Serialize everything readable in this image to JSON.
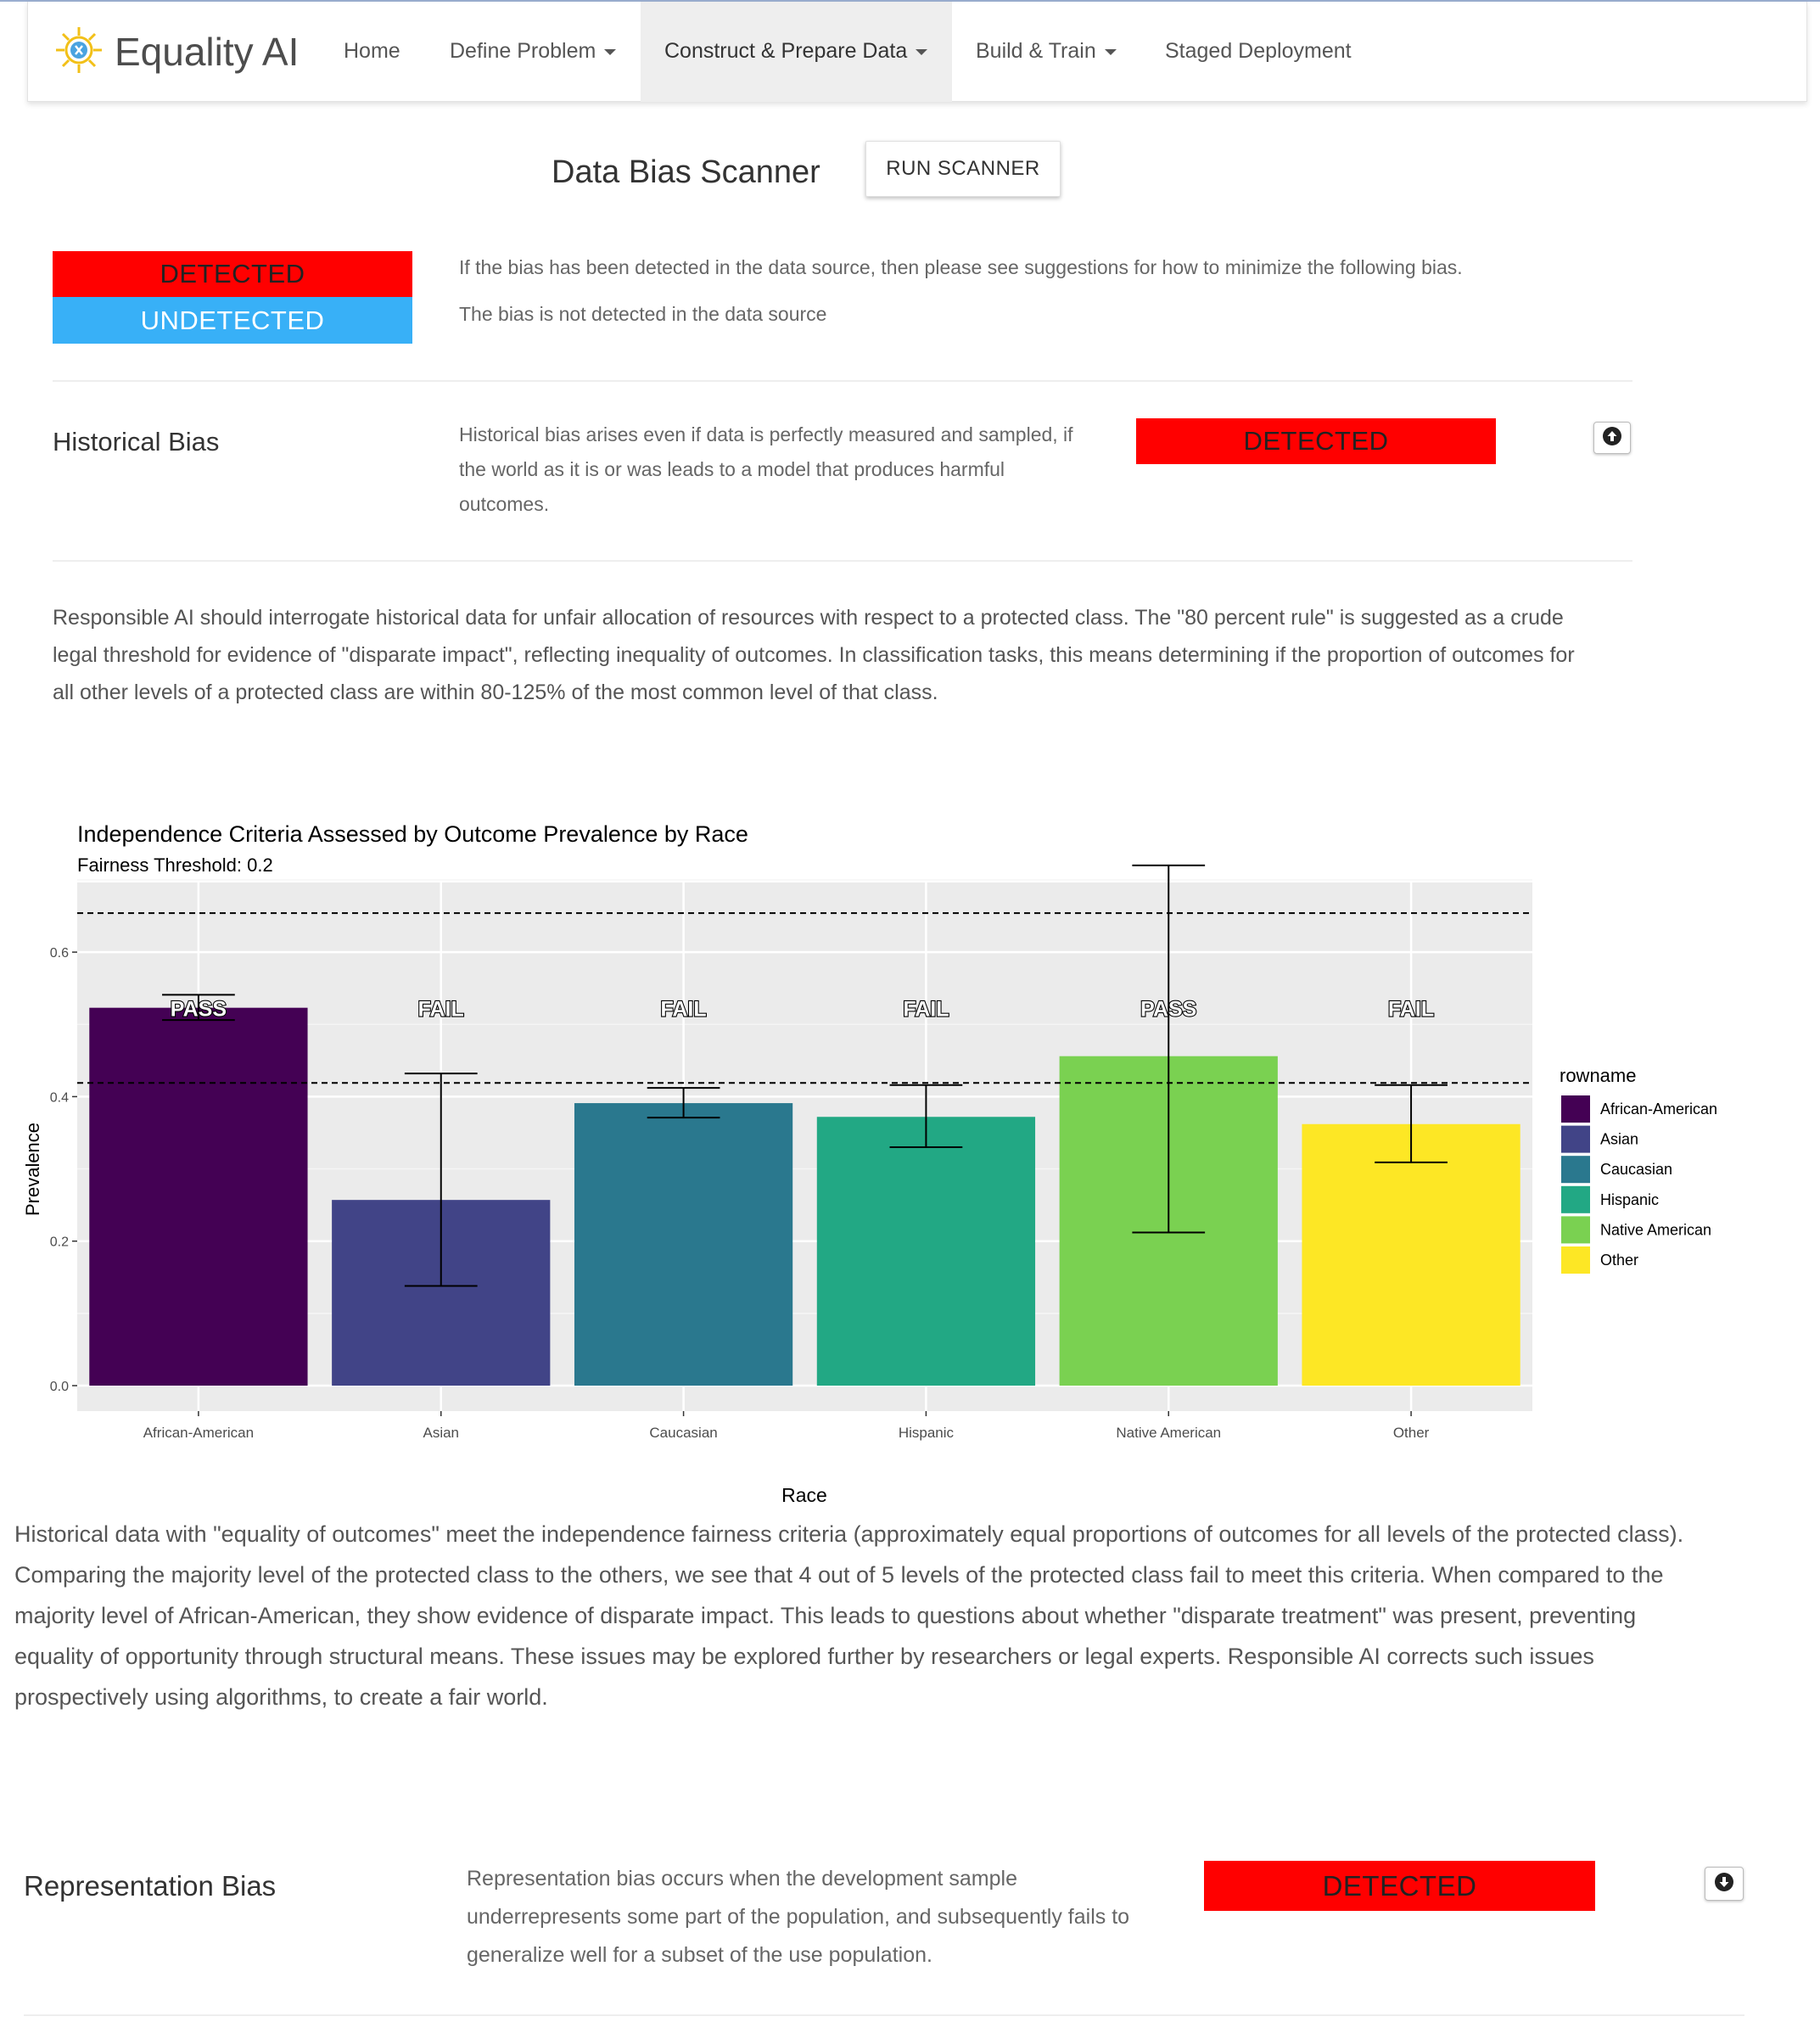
{
  "nav": {
    "brand": "Equality AI",
    "items": [
      {
        "label": "Home",
        "dropdown": false,
        "active": false
      },
      {
        "label": "Define Problem",
        "dropdown": true,
        "active": false
      },
      {
        "label": "Construct & Prepare Data",
        "dropdown": true,
        "active": true
      },
      {
        "label": "Build & Train",
        "dropdown": true,
        "active": false
      },
      {
        "label": "Staged Deployment",
        "dropdown": false,
        "active": false
      }
    ]
  },
  "scanner": {
    "title": "Data Bias Scanner",
    "run_label": "RUN SCANNER",
    "detected_label": "DETECTED",
    "undetected_label": "UNDETECTED",
    "detected_note": "If the bias has been detected in the data source, then please see suggestions for how to minimize the following bias.",
    "undetected_note": "The bias is not detected in the data source"
  },
  "historical": {
    "title": "Historical Bias",
    "desc_lines": [
      "Historical bias arises even if data is perfectly measured and sampled, if",
      "the world as it is or was leads to a model that produces harmful",
      "outcomes."
    ],
    "status": "DETECTED",
    "para_lines": [
      "Responsible AI should interrogate historical data for unfair allocation of resources with respect to a protected class. The \"80 percent rule\" is suggested as a crude",
      "legal threshold for evidence of \"disparate impact\", reflecting inequality of outcomes. In classification tasks, this means determining if the proportion of outcomes for",
      "all other levels of a protected class are within 80-125% of the most common level of that class."
    ]
  },
  "chart_data": {
    "type": "bar",
    "title": "Independence Criteria Assessed by Outcome Prevalence by Race",
    "subtitle": "Fairness Threshold: 0.2",
    "xlabel": "Race",
    "ylabel": "Prevalence",
    "ylim": [
      0,
      0.75
    ],
    "yticks": [
      0.0,
      0.2,
      0.4,
      0.6
    ],
    "ytick_labels": [
      "0.0",
      "0.2",
      "0.4",
      "0.6"
    ],
    "categories": [
      "African-American",
      "Asian",
      "Caucasian",
      "Hispanic",
      "Native American",
      "Other"
    ],
    "values": [
      0.523,
      0.257,
      0.391,
      0.372,
      0.456,
      0.362
    ],
    "error_low": [
      0.506,
      0.138,
      0.371,
      0.33,
      0.212,
      0.309
    ],
    "error_high": [
      0.541,
      0.432,
      0.412,
      0.416,
      0.72,
      0.416
    ],
    "labels": [
      "PASS",
      "FAIL",
      "FAIL",
      "FAIL",
      "PASS",
      "FAIL"
    ],
    "label_y": 0.523,
    "reference_lines": [
      0.419,
      0.654
    ],
    "colors": [
      "#440154",
      "#414487",
      "#2a788e",
      "#22a884",
      "#7ad151",
      "#fde725"
    ],
    "legend_title": "rowname",
    "legend_position": "right",
    "grid": true
  },
  "findings": {
    "lines": [
      "Historical data with \"equality of outcomes\" meet the independence fairness criteria (approximately equal proportions of outcomes for all levels of the protected class).",
      "Comparing the majority level of the protected class to the others, we see that 4 out of 5 levels of the protected class fail to meet this criteria. When compared to the",
      "majority level of African-American, they show evidence of disparate impact. This leads to questions about whether \"disparate treatment\" was present, preventing",
      "equality of opportunity through structural means. These issues may be explored further by researchers or legal experts. Responsible AI corrects such issues",
      "prospectively using algorithms, to create a fair world."
    ]
  },
  "representation": {
    "title": "Representation Bias",
    "desc_lines": [
      "Representation bias occurs when the development sample",
      "underrepresents some part of the population, and subsequently fails to",
      "generalize well for a subset of the use population."
    ],
    "status": "DETECTED"
  },
  "icons": {
    "logo": "equality-ai-logo",
    "collapse": "arrow-circle-up-icon",
    "expand": "arrow-circle-down-icon"
  }
}
